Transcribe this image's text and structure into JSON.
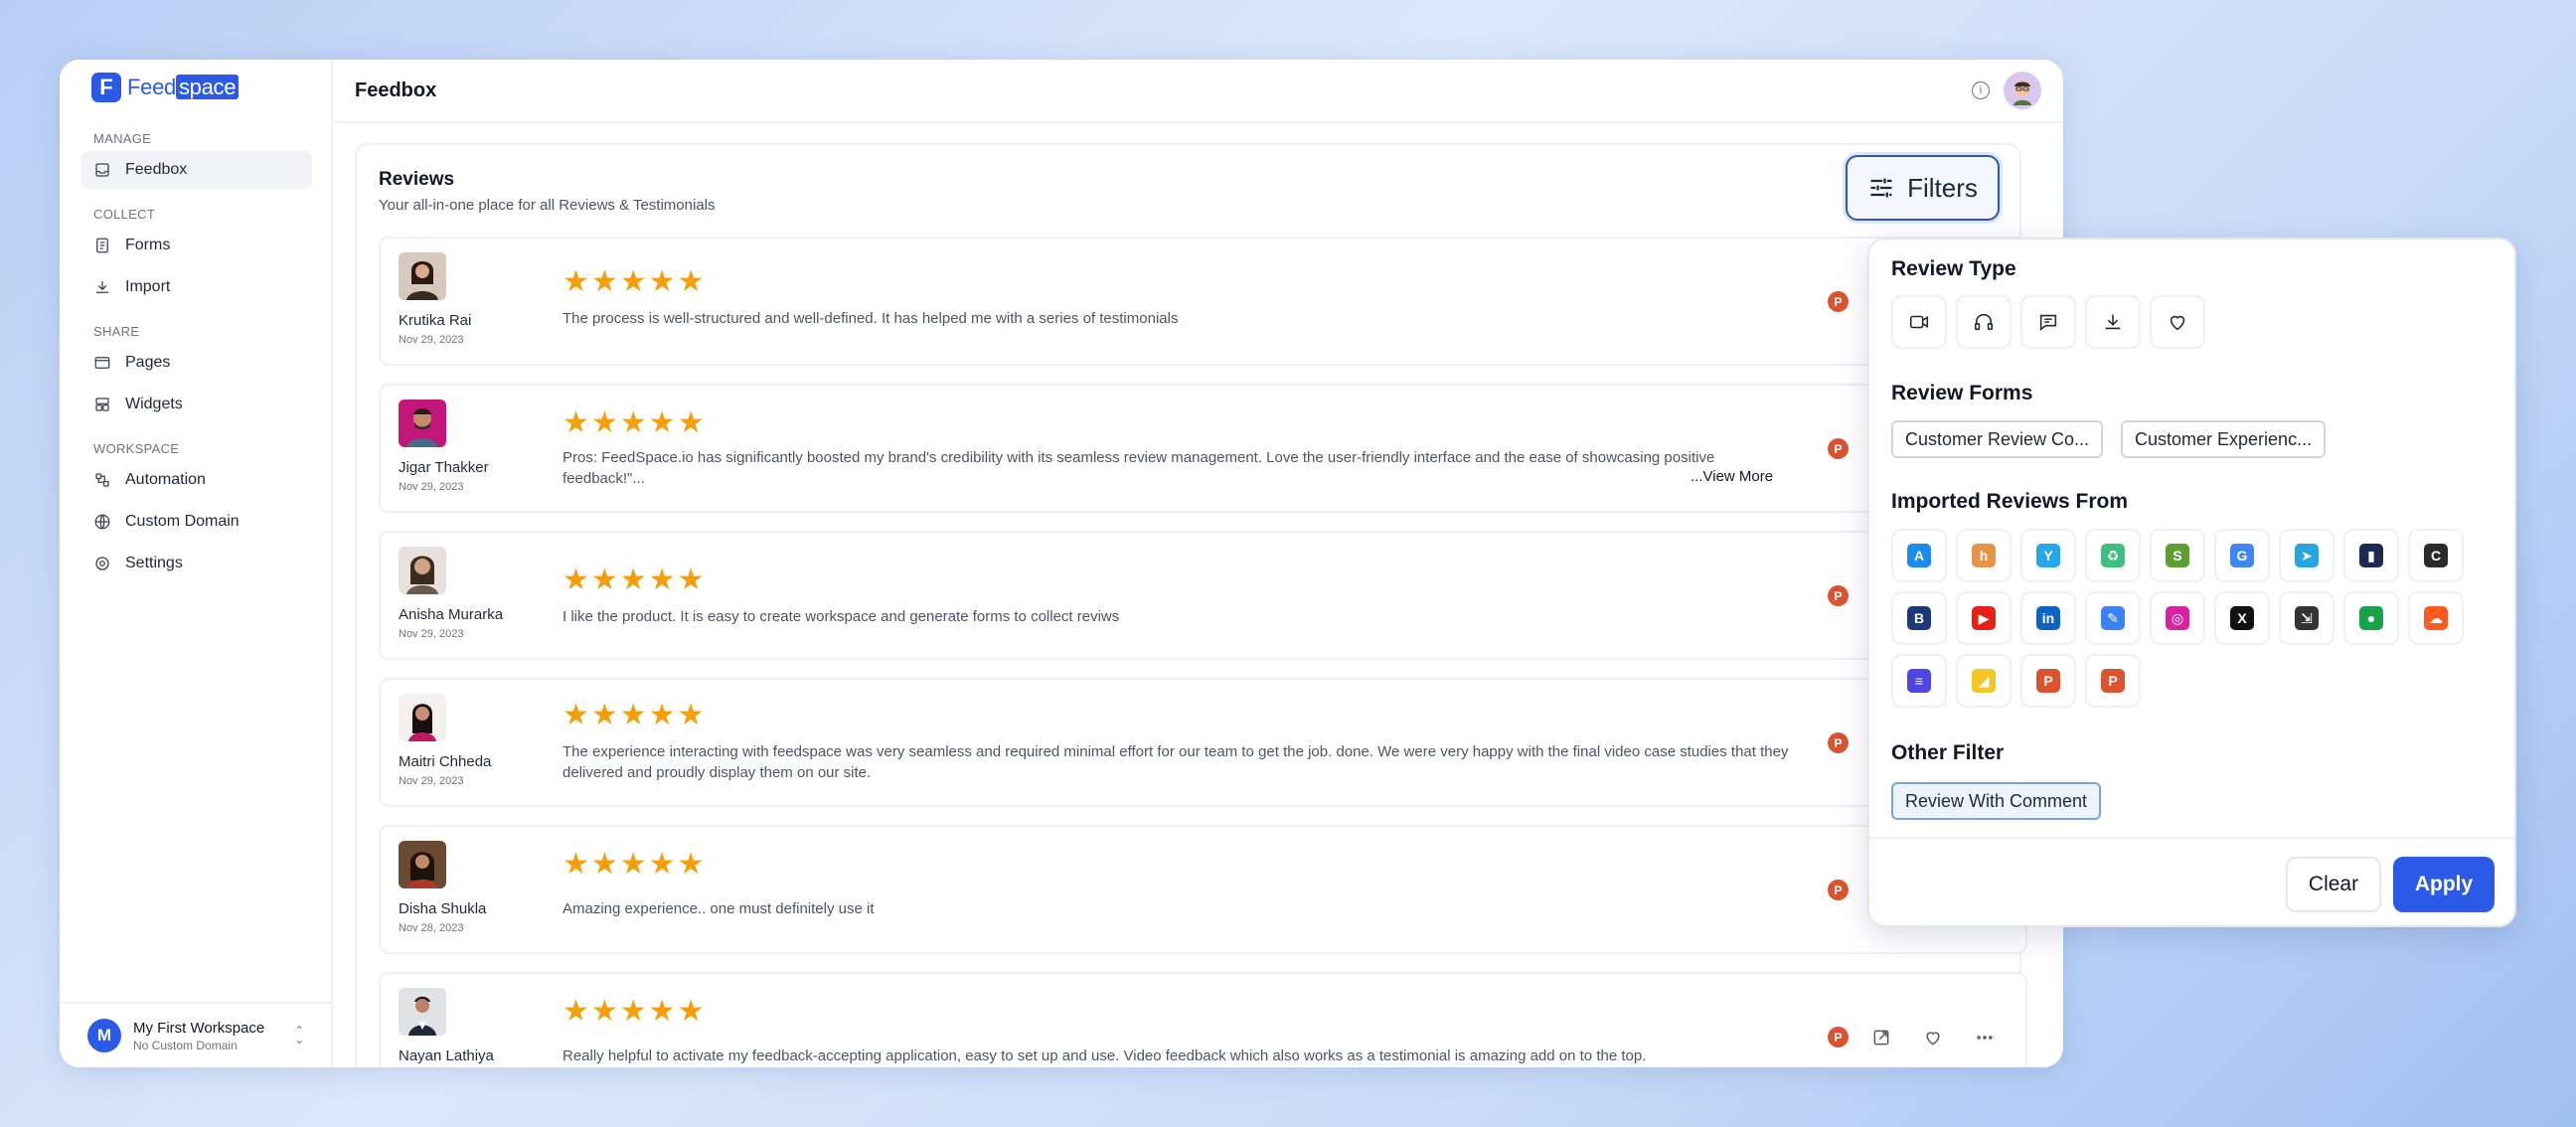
{
  "app": {
    "logo_mark": "F",
    "logo_text_a": "Feed",
    "logo_text_b": "space"
  },
  "sidebar": {
    "sections": [
      {
        "label": "MANAGE",
        "items": [
          {
            "label": "Feedbox",
            "icon": "inbox-icon",
            "active": true
          }
        ]
      },
      {
        "label": "COLLECT",
        "items": [
          {
            "label": "Forms",
            "icon": "form-icon"
          },
          {
            "label": "Import",
            "icon": "download-icon"
          }
        ]
      },
      {
        "label": "SHARE",
        "items": [
          {
            "label": "Pages",
            "icon": "page-icon"
          },
          {
            "label": "Widgets",
            "icon": "widgets-icon"
          }
        ]
      },
      {
        "label": "WORKSPACE",
        "items": [
          {
            "label": "Automation",
            "icon": "automation-icon"
          },
          {
            "label": "Custom Domain",
            "icon": "globe-icon"
          },
          {
            "label": "Settings",
            "icon": "gear-icon"
          }
        ]
      }
    ],
    "workspace": {
      "avatar": "M",
      "name": "My First Workspace",
      "domain": "No Custom Domain"
    }
  },
  "header": {
    "title": "Feedbox",
    "info_glyph": "i"
  },
  "reviews": {
    "title": "Reviews",
    "subtitle": "Your all-in-one place for all Reviews & Testimonials",
    "filters_label": "Filters",
    "stars": "★★★★★",
    "badge": "P",
    "view_more": "...View More",
    "items": [
      {
        "name": "Krutika Rai",
        "date": "Nov 29, 2023",
        "text": "The process is well-structured and well-defined. It has helped me with a series of testimonials",
        "avatar_color": "#3a2a22"
      },
      {
        "name": "Jigar Thakker",
        "date": "Nov 29, 2023",
        "text": "Pros: FeedSpace.io has significantly boosted my brand's credibility with its seamless review management. Love the user-friendly interface and the ease of showcasing positive feedback!\"...",
        "avatar_color": "#c2167a"
      },
      {
        "name": "Anisha Murarka",
        "date": "Nov 29, 2023",
        "text": "I like the product. It is easy to create workspace and generate forms to collect reviws",
        "avatar_color": "#6b5a52"
      },
      {
        "name": "Maitri Chheda",
        "date": "Nov 29, 2023",
        "text": "The experience interacting with feedspace was very seamless and required minimal effort for our team to get the job. done. We were very happy with the final video case studies that they delivered and proudly display them on our site.",
        "avatar_color": "#e9e4e2"
      },
      {
        "name": "Disha Shukla",
        "date": "Nov 28, 2023",
        "text": "Amazing experience.. one must definitely use it",
        "avatar_color": "#4a2a1a"
      },
      {
        "name": "Nayan Lathiya",
        "date": "",
        "text": "Really helpful to activate my feedback-accepting application, easy to set up and use. Video feedback which also works as a testimonial is amazing add on to the top.",
        "avatar_color": "#3b4a5a"
      }
    ]
  },
  "filter_panel": {
    "review_type_title": "Review Type",
    "review_types": [
      "video-icon",
      "audio-icon",
      "text-review-icon",
      "import-icon",
      "heart-icon"
    ],
    "review_forms_title": "Review Forms",
    "review_forms": [
      "Customer Review Co...",
      "Customer Experienc..."
    ],
    "imported_title": "Imported Reviews From",
    "sources": [
      {
        "name": "app-store-icon",
        "color": "#1a8cf0",
        "glyph": "A"
      },
      {
        "name": "houzz-icon",
        "color": "#e6944a",
        "glyph": "h"
      },
      {
        "name": "capterra-icon",
        "color": "#27a7e8",
        "glyph": "Y"
      },
      {
        "name": "recycle-icon",
        "color": "#3fbf7f",
        "glyph": "♻"
      },
      {
        "name": "shopify-icon",
        "color": "#5c9e31",
        "glyph": "S"
      },
      {
        "name": "google-icon",
        "color": "#4285f4",
        "glyph": "G"
      },
      {
        "name": "paper-plane-icon",
        "color": "#27a5e0",
        "glyph": "➤"
      },
      {
        "name": "trustradius-icon",
        "color": "#1d2a52",
        "glyph": "▮"
      },
      {
        "name": "g2-icon",
        "color": "#2b2b2b",
        "glyph": "C"
      },
      {
        "name": "booking-icon",
        "color": "#1c3a7a",
        "glyph": "B"
      },
      {
        "name": "youtube-icon",
        "color": "#e62117",
        "glyph": "▶"
      },
      {
        "name": "linkedin-icon",
        "color": "#0a66c2",
        "glyph": "in"
      },
      {
        "name": "form-edit-icon",
        "color": "#3b82f6",
        "glyph": "✎"
      },
      {
        "name": "instagram-icon",
        "color": "#d6249f",
        "glyph": "◎"
      },
      {
        "name": "x-icon",
        "color": "#111111",
        "glyph": "X"
      },
      {
        "name": "file-import-icon",
        "color": "#333333",
        "glyph": "⇲"
      },
      {
        "name": "tripadvisor-icon",
        "color": "#16a34a",
        "glyph": "●"
      },
      {
        "name": "soundcloud-icon",
        "color": "#ff5a1f",
        "glyph": "☁"
      },
      {
        "name": "trustpilot-icon",
        "color": "#4f46e5",
        "glyph": "≡"
      },
      {
        "name": "cheese-icon",
        "color": "#f3c623",
        "glyph": "◢"
      },
      {
        "name": "producthunt-icon-1",
        "color": "#da552f",
        "glyph": "P"
      },
      {
        "name": "producthunt-icon-2",
        "color": "#da552f",
        "glyph": "P"
      }
    ],
    "other_title": "Other Filter",
    "other_chip": "Review With Comment",
    "clear_label": "Clear",
    "apply_label": "Apply"
  }
}
